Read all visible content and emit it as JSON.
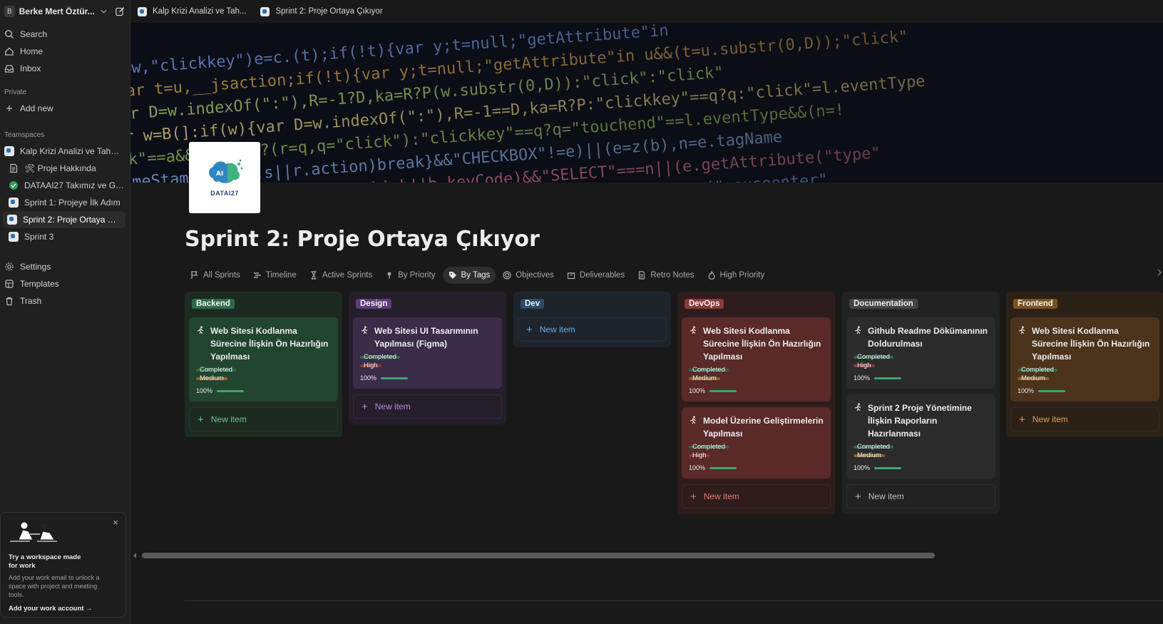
{
  "workspace": {
    "name": "Berke Mert Öztür...",
    "avatar": "B"
  },
  "sidebar": {
    "top": [
      {
        "label": "Search",
        "icon": "search-icon"
      },
      {
        "label": "Home",
        "icon": "home-icon"
      },
      {
        "label": "Inbox",
        "icon": "inbox-icon"
      }
    ],
    "private_header": "Private",
    "add_new": "Add new",
    "teamspaces_header": "Teamspaces",
    "teamspace": "Kalp Krizi Analizi ve Tahmini",
    "pages": [
      {
        "label": "🛠 Proje Hakkında",
        "icon": "document-icon"
      },
      {
        "label": "DATAAI27 Takımız ve Gör...",
        "icon": "check-circle-icon"
      },
      {
        "label": "Sprint 1: Projeye İlk Adım",
        "icon": "page-icon"
      },
      {
        "label": "Sprint 2: Proje Ortaya Çı...",
        "icon": "page-icon",
        "active": true
      },
      {
        "label": "Sprint 3",
        "icon": "page-icon"
      }
    ],
    "bottom": [
      {
        "label": "Settings",
        "icon": "gear-icon"
      },
      {
        "label": "Templates",
        "icon": "templates-icon"
      },
      {
        "label": "Trash",
        "icon": "trash-icon"
      }
    ],
    "promo": {
      "close": "×",
      "title": "Try a workspace made for work",
      "text": "Add your work email to unlock a space with project and meeting tools.",
      "link": "Add your work account →"
    }
  },
  "tabs": [
    {
      "label": "Kalp Krizi Analizi ve Tah..."
    },
    {
      "label": "Sprint 2: Proje Ortaya Çıkıyor"
    }
  ],
  "page": {
    "icon_text": "DATAI27",
    "title": "Sprint 2: Proje Ortaya Çıkıyor"
  },
  "views": [
    {
      "label": "All Sprints",
      "icon": "flag-icon"
    },
    {
      "label": "Timeline",
      "icon": "timeline-icon"
    },
    {
      "label": "Active Sprints",
      "icon": "hourglass-icon"
    },
    {
      "label": "By Priority",
      "icon": "pin-icon"
    },
    {
      "label": "By Tags",
      "icon": "tag-icon",
      "active": true
    },
    {
      "label": "Objectives",
      "icon": "target-icon"
    },
    {
      "label": "Deliverables",
      "icon": "box-icon"
    },
    {
      "label": "Retro Notes",
      "icon": "notes-icon"
    },
    {
      "label": "High Priority",
      "icon": "fire-icon"
    }
  ],
  "board": {
    "new_item_label": "New item",
    "columns": [
      {
        "tag": "Backend",
        "colors": {
          "col": "#1d2a22",
          "card": "#22452f",
          "tag": "#2c6b48",
          "accent": "#6fbf8f"
        },
        "cards": [
          {
            "title": "Web Sitesi Kodlanma Sürecine İlişkin Ön Hazırlığın Yapılması",
            "status": "Completed",
            "priority": "Medium",
            "progress": "100%",
            "progress_value": 1.0
          }
        ]
      },
      {
        "tag": "Design",
        "colors": {
          "col": "#251f2c",
          "card": "#3b2c4a",
          "tag": "#5b3c7a",
          "accent": "#b48ad8"
        },
        "cards": [
          {
            "title": "Web Sitesi UI Tasarımının Yapılması (Figma)",
            "status": "Completed",
            "priority": "High",
            "progress": "100%",
            "progress_value": 1.0
          }
        ]
      },
      {
        "tag": "Dev",
        "colors": {
          "col": "#1e242b",
          "card": "#242c35",
          "tag": "#2b4b6c",
          "accent": "#6fa8e0"
        },
        "cards": []
      },
      {
        "tag": "DevOps",
        "colors": {
          "col": "#2e1d1c",
          "card": "#5a2a28",
          "tag": "#8a3a34",
          "accent": "#e07a6e"
        },
        "cards": [
          {
            "title": "Web Sitesi Kodlanma Sürecine İlişkin Ön Hazırlığın Yapılması",
            "status": "Completed",
            "priority": "Medium",
            "progress": "100%",
            "progress_value": 1.0
          },
          {
            "title": "Model Üzerine Geliştirmelerin Yapılması",
            "status": "Completed",
            "priority": "High",
            "progress": "100%",
            "progress_value": 1.0
          }
        ]
      },
      {
        "tag": "Documentation",
        "colors": {
          "col": "#222222",
          "card": "#2b2b2b",
          "tag": "#454545",
          "accent": "#bdbdbd"
        },
        "cards": [
          {
            "title": "Github Readme Dökümanının Doldurulması",
            "status": "Completed",
            "priority": "High",
            "progress": "100%",
            "progress_value": 1.0
          },
          {
            "title": "Sprint 2 Proje Yönetimine İlişkin Raporların Hazırlanması",
            "status": "Completed",
            "priority": "Medium",
            "progress": "100%",
            "progress_value": 1.0
          }
        ]
      },
      {
        "tag": "Frontend",
        "colors": {
          "col": "#2b2116",
          "card": "#4c331c",
          "tag": "#7a5220",
          "accent": "#e0a05e"
        },
        "cards": [
          {
            "title": "Web Sitesi Kodlanma Sürecine İlişkin Ön Hazırlığın Yapılması",
            "status": "Completed",
            "priority": "Medium",
            "progress": "100%",
            "progress_value": 1.0
          }
        ]
      }
    ]
  },
  "badge_colors": {
    "Completed": "#2d6a49",
    "Medium": "#8a6321",
    "High": "#8c3a35"
  }
}
